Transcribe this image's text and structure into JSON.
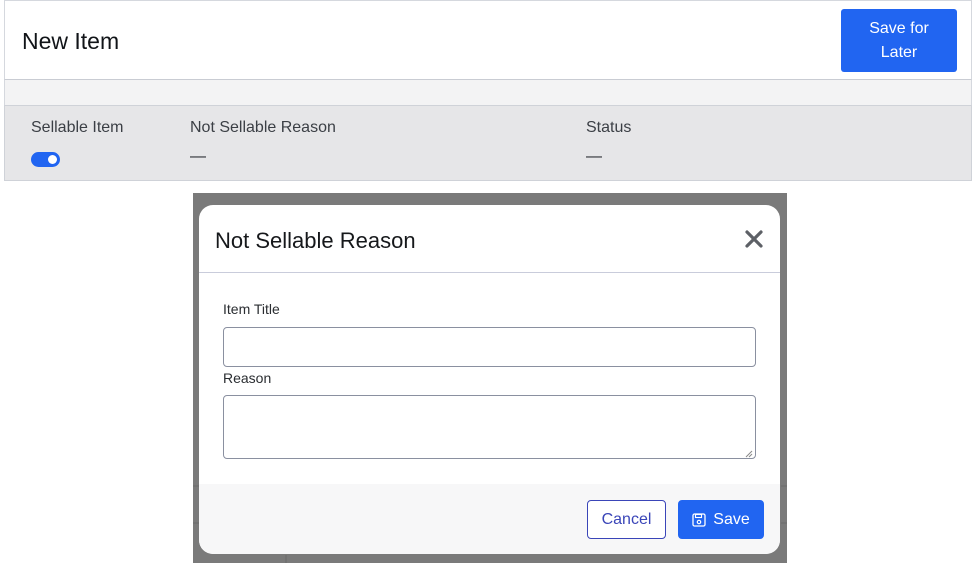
{
  "page": {
    "title": "New Item",
    "save_later_label": "Save for Later"
  },
  "details": {
    "columns": [
      {
        "label": "Sellable Item"
      },
      {
        "label": "Not Sellable Reason",
        "value": "—"
      },
      {
        "label": "Status",
        "value": "—"
      }
    ],
    "sellable_toggle_on": true
  },
  "modal": {
    "title": "Not Sellable Reason",
    "close_icon": "close-icon",
    "fields": {
      "item_title": {
        "label": "Item Title",
        "value": ""
      },
      "reason": {
        "label": "Reason",
        "value": ""
      }
    },
    "cancel_label": "Cancel",
    "save_label": "Save",
    "save_icon": "floppy-disk-icon"
  },
  "colors": {
    "primary": "#2165f1",
    "cancel_outline": "#3a45b8",
    "overlay": "#7a7a7a"
  }
}
